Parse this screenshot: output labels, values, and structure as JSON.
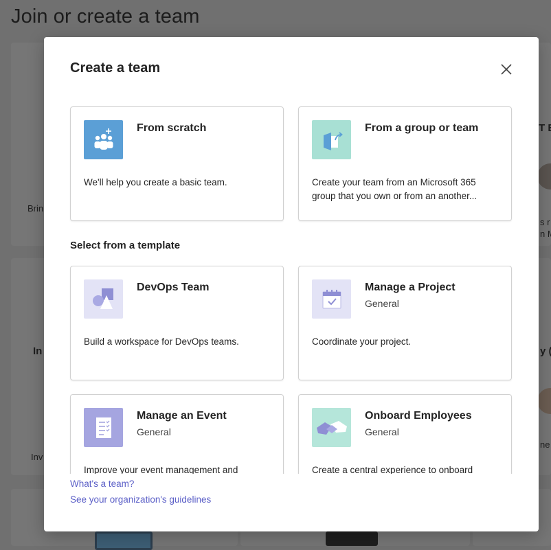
{
  "background": {
    "page_title": "Join or create a team",
    "fragments": {
      "left_top": "Brin",
      "left_mid": "In",
      "left_low": "Inv",
      "right_top": "T E",
      "right_mid_1": "s r",
      "right_mid_2": "n M",
      "right_low_1": "y (",
      "right_low_2": "ne"
    }
  },
  "dialog": {
    "title": "Create a team",
    "close_label": "×",
    "top_cards": [
      {
        "title": "From scratch",
        "description": "We'll help you create a basic team."
      },
      {
        "title": "From a group or team",
        "description": "Create your team from an Microsoft 365 group that you own or from an another..."
      }
    ],
    "template_section_label": "Select from a template",
    "templates": [
      {
        "title": "DevOps Team",
        "subtitle": "",
        "description": "Build a workspace for DevOps teams."
      },
      {
        "title": "Manage a Project",
        "subtitle": "General",
        "description": "Coordinate your project."
      },
      {
        "title": "Manage an Event",
        "subtitle": "General",
        "description": "Improve your event management and"
      },
      {
        "title": "Onboard Employees",
        "subtitle": "General",
        "description": "Create a central experience to onboard"
      }
    ],
    "links": {
      "whats_a_team": "What's a team?",
      "guidelines": "See your organization's guidelines"
    }
  },
  "colors": {
    "scratch_tile": "#5b9fd6",
    "group_tile": "#a8e0d4",
    "devops_tile": "#e3e3f6",
    "project_tile": "#e3e3f6",
    "event_tile": "#a5a5e0",
    "onboard_tile": "#b5e6da",
    "link": "#5b5fc7"
  },
  "icons": {
    "scratch": "people-add-icon",
    "group": "group-share-icon",
    "devops": "shapes-icon",
    "project": "calendar-check-icon",
    "event": "checklist-icon",
    "onboard": "handshake-icon",
    "close": "close-icon"
  }
}
